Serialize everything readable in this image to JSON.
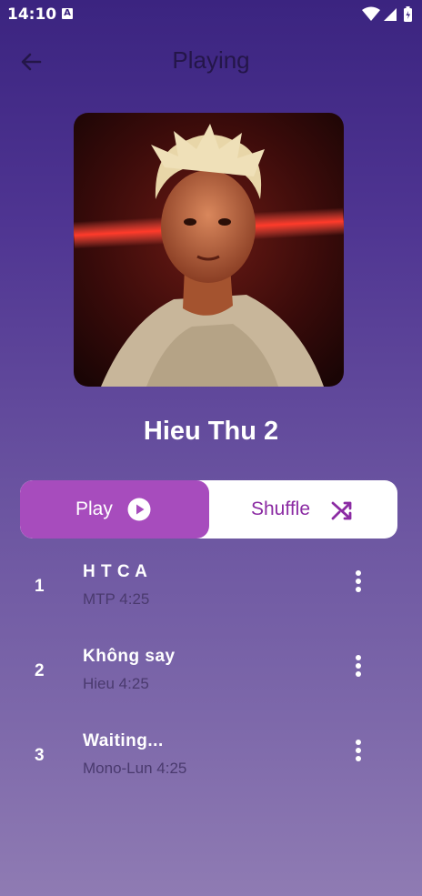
{
  "status": {
    "time": "14:10",
    "notification_badge": "A"
  },
  "header": {
    "title": "Playing"
  },
  "artist": {
    "name": "Hieu Thu 2"
  },
  "controls": {
    "play_label": "Play",
    "shuffle_label": "Shuffle"
  },
  "tracks": [
    {
      "number": "1",
      "title": "H T C A",
      "subtitle": "MTP 4:25"
    },
    {
      "number": "2",
      "title": "Không say",
      "subtitle": "Hieu 4:25"
    },
    {
      "number": "3",
      "title": "Waiting...",
      "subtitle": "Mono-Lun 4:25"
    }
  ],
  "colors": {
    "accent": "#a74cbd",
    "shuffle_text": "#8b2ba3",
    "background_top": "#3b2480",
    "background_bottom": "#8f7bb3"
  },
  "icons": {
    "back": "arrow-left-icon",
    "play": "play-circle-icon",
    "shuffle": "shuffle-icon",
    "more": "more-vert-icon"
  }
}
